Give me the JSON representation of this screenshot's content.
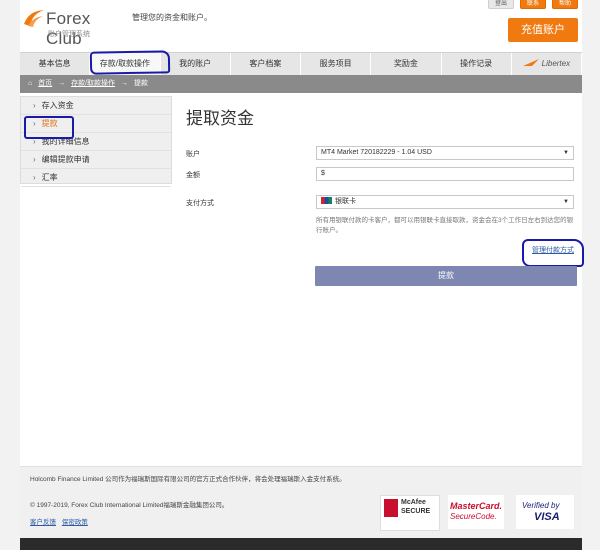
{
  "header": {
    "brand_name": "Forex Club",
    "brand_sub": "账户管理系统",
    "tagline": "管理您的资金和账户。",
    "top_links": [
      "登出",
      "联系",
      "帮助"
    ],
    "deposit_button": "充值账户"
  },
  "nav": {
    "tabs": [
      {
        "label": "基本信息"
      },
      {
        "label": "存款/取款操作"
      },
      {
        "label": "我的账户"
      },
      {
        "label": "客户档案"
      },
      {
        "label": "服务项目"
      },
      {
        "label": "奖励金"
      },
      {
        "label": "操作记录"
      },
      {
        "label": "Libertex"
      }
    ],
    "active_index": 1
  },
  "breadcrumb": {
    "home_icon": "home-icon",
    "items": [
      "首页",
      "存款/取款操作",
      "提款"
    ],
    "separator": "→"
  },
  "sidebar": {
    "items": [
      {
        "label": "存入资金"
      },
      {
        "label": "提款"
      },
      {
        "label": "我的详细信息"
      },
      {
        "label": "编辑提款申请"
      },
      {
        "label": "汇率"
      }
    ],
    "active_index": 1
  },
  "main": {
    "title": "提取资金",
    "account_label": "账户",
    "account_value": "MT4 Market 720182229 - 1.04 USD",
    "amount_label": "金额",
    "amount_value": "$",
    "method_label": "支付方式",
    "method_value": "银联卡",
    "hint": "所有用银联付款的卡客户，都可以用银联卡直接取款，资金会在3个工作日左右到达您的银行账户。",
    "manage_link": "管理付款方式",
    "submit_button": "提款"
  },
  "footer": {
    "legal": "Holcomb Finance Limited 公司作为福瑞斯国际有限公司的官方正式合作伙伴，将会处理福瑞斯入金支付系统。",
    "copyright": "© 1997-2019, Forex Club International Limited福瑞斯金融集团公司。",
    "links": [
      "客户反馈",
      "保密政策"
    ],
    "seals": {
      "mcafee": [
        "McAfee",
        "SECURE"
      ],
      "mastercard": [
        "MasterCard.",
        "SecureCode."
      ],
      "visa": [
        "Verified by",
        "VISA"
      ]
    }
  },
  "colors": {
    "accent_orange": "#f07a10",
    "annotation_blue": "#1a1aa8",
    "button_purple": "#7e86b2",
    "link_blue": "#2a5aa8"
  }
}
